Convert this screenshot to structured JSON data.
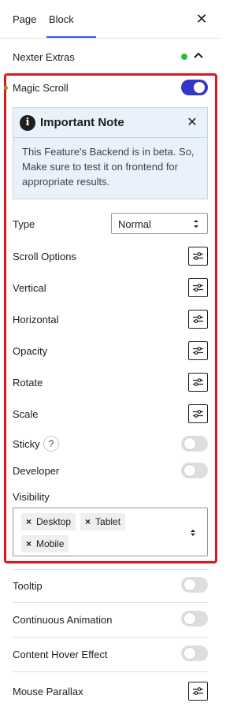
{
  "tabs": {
    "page": "Page",
    "block": "Block",
    "close_icon": "close-icon"
  },
  "section": {
    "title": "Nexter Extras",
    "status_color": "#1ec243"
  },
  "magic_scroll": {
    "label": "Magic Scroll",
    "enabled": true
  },
  "note": {
    "title": "Important Note",
    "body": "This Feature's Backend is in beta. So, Make sure to test it on frontend for appropriate results.",
    "icon": "info-icon"
  },
  "type": {
    "label": "Type",
    "value": "Normal"
  },
  "settings": {
    "scroll_options": "Scroll Options",
    "vertical": "Vertical",
    "horizontal": "Horizontal",
    "opacity": "Opacity",
    "rotate": "Rotate",
    "scale": "Scale"
  },
  "sticky": {
    "label": "Sticky",
    "help": "?",
    "enabled": false
  },
  "developer": {
    "label": "Developer",
    "enabled": false
  },
  "visibility": {
    "label": "Visibility",
    "chips": [
      "Desktop",
      "Tablet",
      "Mobile"
    ],
    "remove": "×"
  },
  "extras": {
    "tooltip": "Tooltip",
    "continuous_animation": "Continuous Animation",
    "content_hover_effect": "Content Hover Effect",
    "mouse_parallax": "Mouse Parallax"
  },
  "colors": {
    "accent": "#3237c5",
    "highlight_frame": "#e0161a",
    "tab_underline": "#3858e9"
  }
}
